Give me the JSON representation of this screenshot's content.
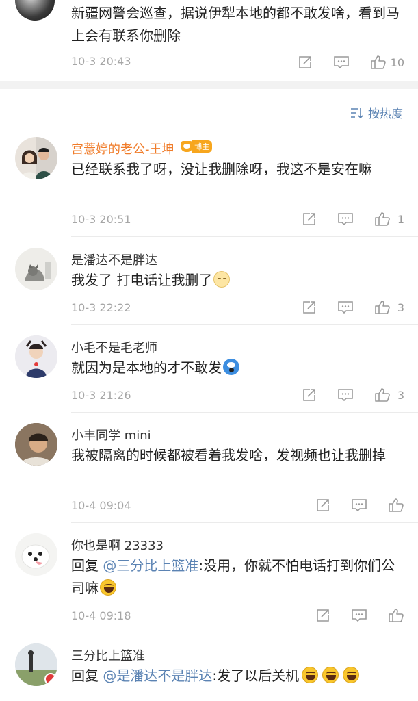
{
  "top_comment": {
    "text": "新疆网警会巡查，据说伊犁本地的都不敢发啥，看到马上会有联系你删除",
    "time": "10-3 20:43",
    "likes": "10"
  },
  "sort": {
    "label": "按热度"
  },
  "comments": [
    {
      "name": "宫薏婷的老公-王坤",
      "badge": "博主",
      "body": "已经联系我了呀，没让我删除呀，我这不是安在嘛",
      "time": "10-3 20:51",
      "likes": "1"
    },
    {
      "name": "是潘达不是胖达",
      "body": "我发了 打电话让我删了",
      "time": "10-3 22:22",
      "likes": "3"
    },
    {
      "name": "小毛不是毛老师",
      "body": "就因为是本地的才不敢发",
      "time": "10-3 21:26",
      "likes": "3"
    },
    {
      "name": "小丰同学 mini",
      "body": "我被隔离的时候都被看着我发啥，发视频也让我删掉",
      "time": "10-4 09:04",
      "likes": ""
    },
    {
      "name": "你也是啊 23333",
      "reply_prefix": "回复",
      "mention": "@三分比上篮准",
      "body": ":没用，你就不怕电话打到你们公司嘛",
      "time": "10-4 09:18",
      "likes": ""
    },
    {
      "name": "三分比上篮准",
      "reply_prefix": "回复",
      "mention": "@是潘达不是胖达",
      "body": ":发了以后关机",
      "time": "",
      "likes": ""
    }
  ],
  "colors": {
    "link": "#5b83b3",
    "owner_name": "#f07c2a",
    "badge": "#f7a61e",
    "meta": "#a6a6a6"
  },
  "icons": [
    "share-icon",
    "comment-icon",
    "like-icon",
    "sort-icon"
  ]
}
